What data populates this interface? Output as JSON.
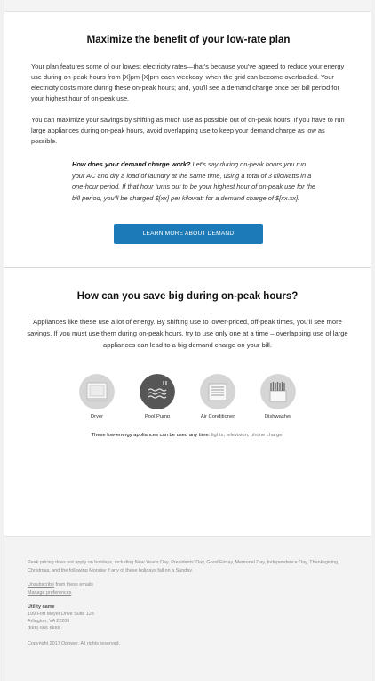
{
  "plan": {
    "title": "Maximize the benefit of your low-rate plan",
    "para1": "Your plan features some of our lowest electricity rates—that's because you've agreed to reduce your energy use during on-peak hours from [X]pm-[X]pm each weekday, when the grid can become overloaded. Your electricity costs more during these on-peak hours; and, you'll see a demand charge once per bill period for your highest hour of on-peak use.",
    "para2": "You can maximize your savings by shifting as much use as possible out of on-peak hours. If you have to run large appliances during on-peak hours, avoid overlapping use to keep your demand charge as low as possible.",
    "callout_question": "How does your demand charge work?",
    "callout_body": " Let's say during on-peak hours you run your AC and dry a load of laundry at the same time, using a total of 3 kilowatts in a one-hour period. If that hour turns out to be your highest hour of on-peak use for the bill period, you'll be charged $[xx] per kilowatt for a demand charge of $[xx.xx].",
    "button_label": "LEARN MORE ABOUT DEMAND"
  },
  "save": {
    "title": "How can you save big during on-peak hours?",
    "body": "Appliances like these use a lot of energy. By shifting use to lower-priced, off-peak times, you'll see more savings. If you must use them during on-peak hours, try to use only one at a time – overlapping use of large appliances can lead to a big demand charge on your bill.",
    "appliances": [
      {
        "label": "Dryer",
        "icon": "dryer-icon"
      },
      {
        "label": "Pool Pump",
        "icon": "pool-pump-icon"
      },
      {
        "label": "Air Conditioner",
        "icon": "air-conditioner-icon"
      },
      {
        "label": "Dishwasher",
        "icon": "dishwasher-icon"
      }
    ],
    "low_lead": "These low-energy appliances can be used any time:",
    "low_items": " lights, television, phone charger"
  },
  "footer": {
    "disclaimer": "Peak pricing does not apply on holidays, including New Year's Day, Presidents' Day, Good Friday, Memorial Day, Independence Day, Thanksgiving, Christmas, and the following Monday if any of these holidays fall on a Sunday.",
    "unsubscribe_link": "Unsubscribe",
    "unsubscribe_rest": " from these emails",
    "manage_link": "Manage preferences",
    "utility_name": "Utility name",
    "address1": "199 Fort Meyer Drive Suite 123",
    "address2": "Arlington, VA 22209",
    "phone": "(555) 555-5555",
    "copyright": "Copyright 2017 Opower. All rights reserved."
  },
  "colors": {
    "button": "#1b7ab7",
    "icon_circle": "#565656",
    "icon_light": "#e4e4e4"
  }
}
